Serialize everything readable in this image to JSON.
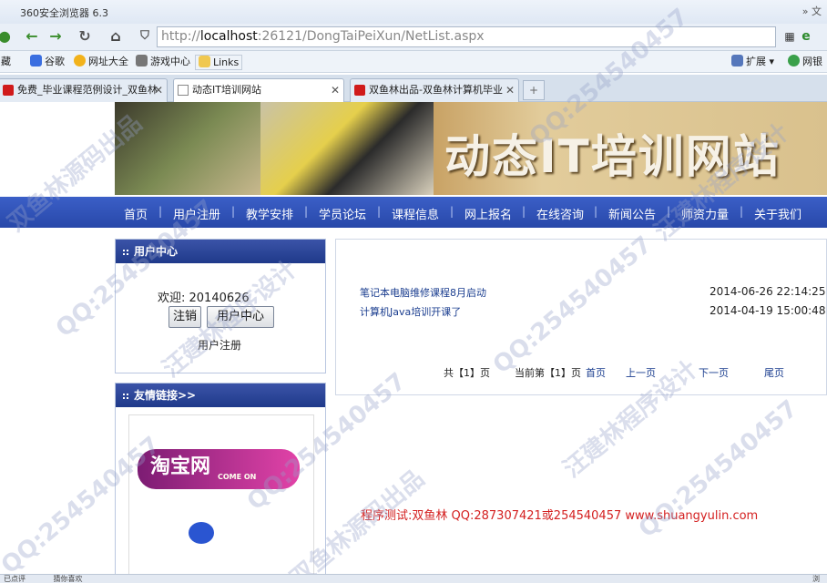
{
  "browser": {
    "window_title": "360安全浏览器 6.3",
    "top_right": "» 文",
    "url_host": "localhost",
    "url_rest": ":26121/DongTaiPeiXun/NetList.aspx",
    "url_scheme": "http://",
    "bookmarks": [
      "谷歌",
      "网址大全",
      "游戏中心",
      "Links"
    ],
    "bookmark_left": "藏",
    "right_tools": [
      "扩展",
      "网银"
    ],
    "tabs": [
      {
        "label": "免费_毕业课程范例设计_双鱼林",
        "active": false
      },
      {
        "label": "动态IT培训网站",
        "active": true
      },
      {
        "label": "双鱼林出品-双鱼林计算机毕业",
        "active": false
      }
    ],
    "status_left": "已点评",
    "status_mid": "猜你喜欢",
    "status_right": "浏"
  },
  "site": {
    "title": "动态IT培训网站",
    "nav": [
      "首页",
      "用户注册",
      "教学安排",
      "学员论坛",
      "课程信息",
      "网上报名",
      "在线咨询",
      "新闻公告",
      "师资力量",
      "关于我们"
    ],
    "user_center": {
      "heading": "用户中心",
      "welcome": "欢迎: 20140626",
      "logout_label": "注销",
      "center_label": "用户中心",
      "register_label": "用户注册"
    },
    "friend_links": {
      "heading": "友情链接>>",
      "taobao_text": "淘宝网",
      "taobao_sub": "COME ON"
    },
    "news": [
      {
        "title": "笔记本电脑维修课程8月启动",
        "date": "2014-06-26 22:14:25"
      },
      {
        "title": "计算机Java培训开课了",
        "date": "2014-04-19 15:00:48"
      }
    ],
    "pager": {
      "total": "共【1】页",
      "current": "当前第【1】页",
      "first": "首页",
      "prev": "上一页",
      "next": "下一页",
      "last": "尾页"
    },
    "footer": "程序测试:双鱼林 QQ:287307421或254540457 www.shuangyulin.com"
  },
  "watermarks": [
    "QQ:254540457",
    "汪建林程序设计",
    "双鱼林源码出品"
  ],
  "colors": {
    "nav_bg": "#2848a9",
    "footer_text": "#d42020",
    "link": "#1a3d8f"
  }
}
